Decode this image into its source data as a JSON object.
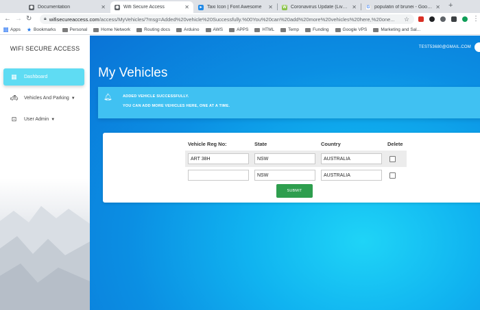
{
  "browser": {
    "tabs": [
      {
        "title": "Documentation",
        "icon": "globe-icon"
      },
      {
        "title": "Wifi Secure Access",
        "icon": "globe-icon",
        "active": true
      },
      {
        "title": "Taxi Icon | Font Awesome",
        "icon": "font-awesome-icon"
      },
      {
        "title": "Coronavirus Update (Live): 1,2",
        "icon": "worldometer-icon"
      },
      {
        "title": "populatin of brunei - Google Se",
        "icon": "google-icon"
      }
    ],
    "url_host": "wifisecureaccess.com",
    "url_path": "/access/MyVehicles/?msg=Added%20vehicle%20Successfully.%00You%20can%20add%20more%20vehicles%20here,%20one..."
  },
  "bookmarks": [
    "Apps",
    "Bookmarks",
    "Personal",
    "Home Network",
    "Routing docs",
    "Arduino",
    "AWS",
    "APPS",
    "HTML",
    "Temp",
    "Funding",
    "Google VPS",
    "Marketing and Sal..."
  ],
  "sidebar": {
    "brand": "WIFI SECURE ACCESS",
    "items": [
      {
        "label": "Dashboard",
        "icon": "dashboard-icon",
        "active": true
      },
      {
        "label": "Vehicles And Parking",
        "icon": "taxi-icon",
        "caret": true
      },
      {
        "label": "User Admin",
        "icon": "user-admin-icon",
        "caret": true
      }
    ]
  },
  "header": {
    "user_email": "TEST53680@GMAIL.COM"
  },
  "main": {
    "title": "My Vehicles",
    "alert": {
      "line1": "ADDED VEHICLE SUCCESSFULLY.",
      "line2": "YOU CAN ADD MORE VEHICLES HERE, ONE AT A TIME."
    },
    "table": {
      "headers": [
        "Vehicle Reg No:",
        "State",
        "Country",
        "Delete"
      ],
      "rows": [
        {
          "reg": "ART 38H",
          "state": "NSW",
          "country": "AUSTRALIA",
          "delete": false
        },
        {
          "reg": "",
          "state": "NSW",
          "country": "AUSTRALIA",
          "delete": false
        }
      ]
    },
    "submit_label": "SUBMIT"
  },
  "colors": {
    "accent": "#5fdcf3",
    "alert": "#40c1f2",
    "submit": "#2e9e4e",
    "main_bg": "#0b8fe3"
  }
}
